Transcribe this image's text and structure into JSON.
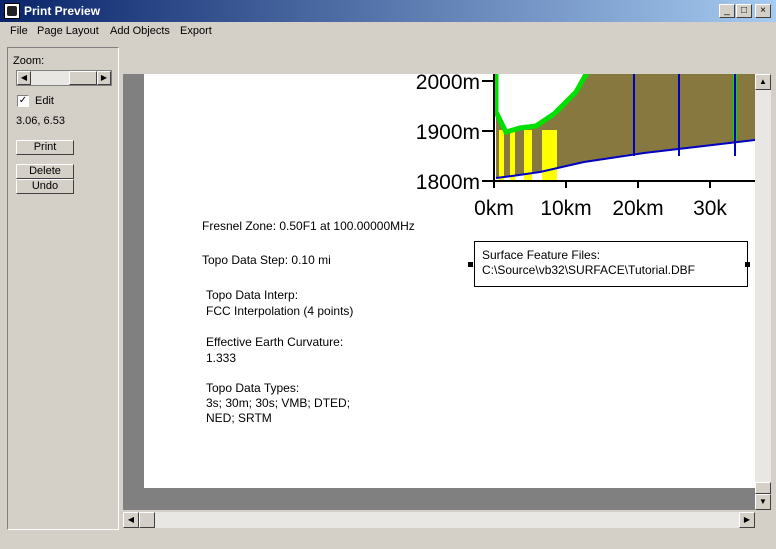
{
  "window": {
    "title": "Print Preview",
    "controls": {
      "minimize": "_",
      "maximize": "□",
      "close": "×"
    }
  },
  "menu": [
    "File",
    "Page Layout",
    "Add Objects",
    "Export"
  ],
  "sidebar": {
    "zoom_label": "Zoom:",
    "edit_checked": true,
    "edit_label": "Edit",
    "coordinates": "3.06, 6.53",
    "buttons": {
      "print": "Print",
      "delete": "Delete",
      "undo": "Undo"
    }
  },
  "page": {
    "fresnel_zone": "Fresnel Zone: 0.50F1 at 100.00000MHz",
    "topo_step": "Topo Data Step: 0.10 mi",
    "topo_interp_label": "Topo Data Interp:",
    "topo_interp_value": "FCC Interpolation (4 points)",
    "earth_curvature_label": "Effective Earth Curvature:",
    "earth_curvature_value": "1.333",
    "topo_types_label": "Topo Data Types:",
    "topo_types_line1": "3s; 30m; 30s; VMB; DTED;",
    "topo_types_line2": "NED; SRTM",
    "surface_files_label": "Surface Feature Files:",
    "surface_files_value": "C:\\Source\\vb32\\SURFACE\\Tutorial.DBF"
  },
  "chart_data": {
    "type": "area",
    "title": "",
    "xlabel": "",
    "ylabel": "",
    "y_ticks": [
      "2000m",
      "1900m",
      "1800m"
    ],
    "x_ticks": [
      "0km",
      "10km",
      "20km",
      "30k"
    ],
    "ylim": [
      1800,
      2000
    ],
    "colors": {
      "terrain_fill": "#86783f",
      "fresnel_line": "#00e000",
      "curvature_line": "#0000c0",
      "clearance_bars": "#ffff00"
    }
  }
}
